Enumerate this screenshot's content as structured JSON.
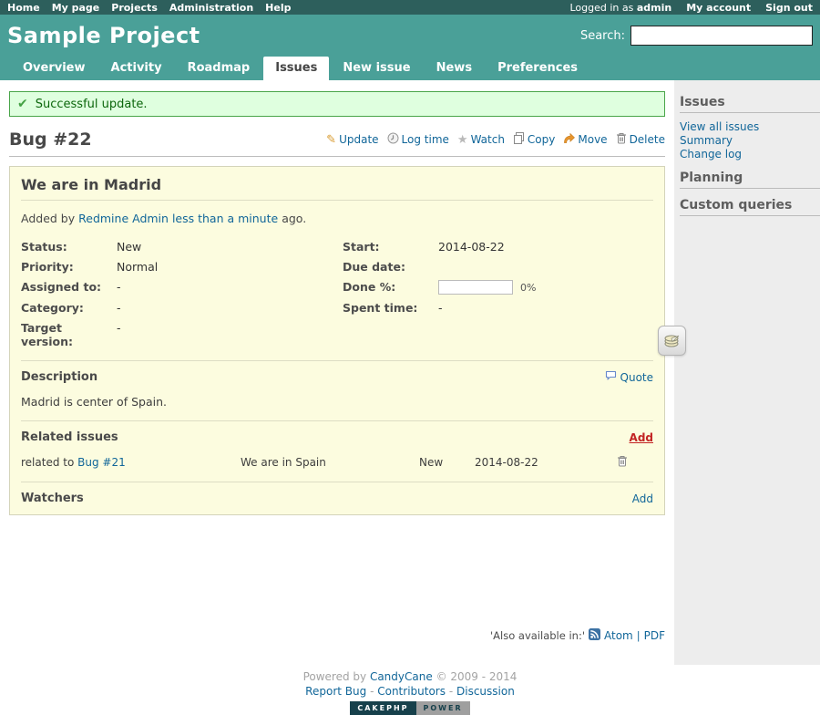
{
  "topbar": {
    "left": [
      {
        "label": "Home"
      },
      {
        "label": "My page"
      },
      {
        "label": "Projects"
      },
      {
        "label": "Administration"
      },
      {
        "label": "Help"
      }
    ],
    "logged_in_prefix": "Logged in as",
    "username": "admin",
    "right": [
      {
        "label": "My account"
      },
      {
        "label": "Sign out"
      }
    ]
  },
  "header": {
    "title": "Sample Project",
    "search_label": "Search:",
    "search_value": ""
  },
  "tabs": [
    {
      "label": "Overview"
    },
    {
      "label": "Activity"
    },
    {
      "label": "Roadmap"
    },
    {
      "label": "Issues"
    },
    {
      "label": "New issue"
    },
    {
      "label": "News"
    },
    {
      "label": "Preferences"
    }
  ],
  "flash": {
    "message": "Successful update."
  },
  "page": {
    "title": "Bug #22"
  },
  "actions": {
    "update": "Update",
    "log_time": "Log time",
    "watch": "Watch",
    "copy": "Copy",
    "move": "Move",
    "delete": "Delete"
  },
  "issue": {
    "subject": "We are in Madrid",
    "added_by_prefix": "Added by",
    "author": "Redmine Admin",
    "added_time": "less than a minute",
    "added_suffix": "ago.",
    "attrs": {
      "status_label": "Status:",
      "status": "New",
      "priority_label": "Priority:",
      "priority": "Normal",
      "assigned_label": "Assigned to:",
      "assigned": "-",
      "category_label": "Category:",
      "category": "-",
      "target_label": "Target version:",
      "target": "-",
      "start_label": "Start:",
      "start": "2014-08-22",
      "due_label": "Due date:",
      "due": "",
      "done_label": "Done %:",
      "done": "0%",
      "spent_label": "Spent time:",
      "spent": "-"
    },
    "description": {
      "heading": "Description",
      "quote_label": "Quote",
      "text": "Madrid is center of Spain."
    },
    "related": {
      "heading": "Related issues",
      "add_label": "Add",
      "rows": [
        {
          "relation": "related to",
          "issue_link": "Bug #21",
          "subject": "We are in Spain",
          "status": "New",
          "start_date": "2014-08-22"
        }
      ]
    },
    "watchers": {
      "heading": "Watchers",
      "add_label": "Add"
    }
  },
  "sidebar": {
    "sections": [
      {
        "heading": "Issues",
        "links": [
          "View all issues",
          "Summary",
          "Change log"
        ]
      },
      {
        "heading": "Planning"
      },
      {
        "heading": "Custom queries"
      }
    ]
  },
  "other_formats": {
    "label": "'Also available in:'",
    "atom_label": "Atom",
    "separator": "|",
    "pdf_label": "PDF"
  },
  "footer": {
    "powered_prefix": "Powered by",
    "powered_link": "CandyCane",
    "copyright": "© 2009 - 2014",
    "link1": "Report Bug",
    "link2": "Contributors",
    "link3": "Discussion",
    "separator": "-",
    "badge_left": "CAKEPHP",
    "badge_right": "POWER"
  },
  "icons": {
    "checkmark-icon": "✔",
    "pencil-icon": "✎",
    "star-icon": "★",
    "clock-icon": "clock svg",
    "copy-icon": "two pages svg",
    "move-icon": "curved orange arrow svg",
    "trash-icon": "trash can svg",
    "quote-icon": "speech bubble svg",
    "atom-icon": "rss feed svg",
    "cake-icon": "layered cake svg"
  },
  "colors": {
    "topbar_bg": "#2d5f5c",
    "header_bg": "#4aa098",
    "link_blue": "#116699",
    "flash_bg": "#dfffdf",
    "flash_border": "#49a549",
    "flash_text": "#0c660c",
    "issue_box_bg": "#fcfcdf",
    "issue_box_border": "#d4d4ba",
    "add_red": "#c22323",
    "badge_navy": "#16404b",
    "rss_blue": "#3d72a4"
  }
}
